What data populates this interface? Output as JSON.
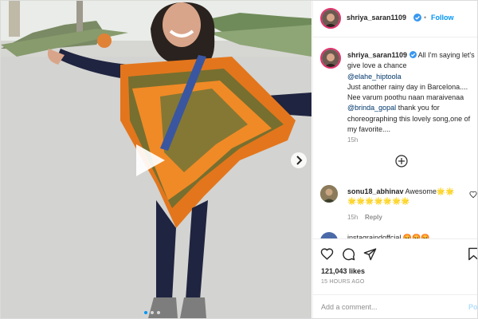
{
  "post": {
    "username": "shriya_saran1109",
    "follow_sep": "•",
    "follow_label": "Follow",
    "caption": {
      "line1": "All I'm saying let's give love a chance",
      "mention1": "@elahe_hiptoola",
      "line2": "Just another rainy day in Barcelona....",
      "line3": "Nee varum poothu naan maraivenaa",
      "mention2": "@brinda_gopal",
      "line4": "thank you for choreographing this lovely song,one of my favorite....",
      "time": "15h"
    },
    "comment": {
      "username": "sonu18_abhinav",
      "text": "Awesome🌟🌟",
      "emojis": "🌟🌟🌟🌟🌟🌟🌟",
      "time": "15h",
      "reply_label": "Reply"
    },
    "next_comment_partial": "instagraindoffcial 😡😡😡",
    "likes": "121,043 likes",
    "timestamp": "15 HOURS AGO",
    "comment_placeholder": "Add a comment...",
    "post_button": "Post"
  },
  "colors": {
    "accent": "#0095f6",
    "link": "#00376b",
    "muted": "#8e8e8e"
  }
}
